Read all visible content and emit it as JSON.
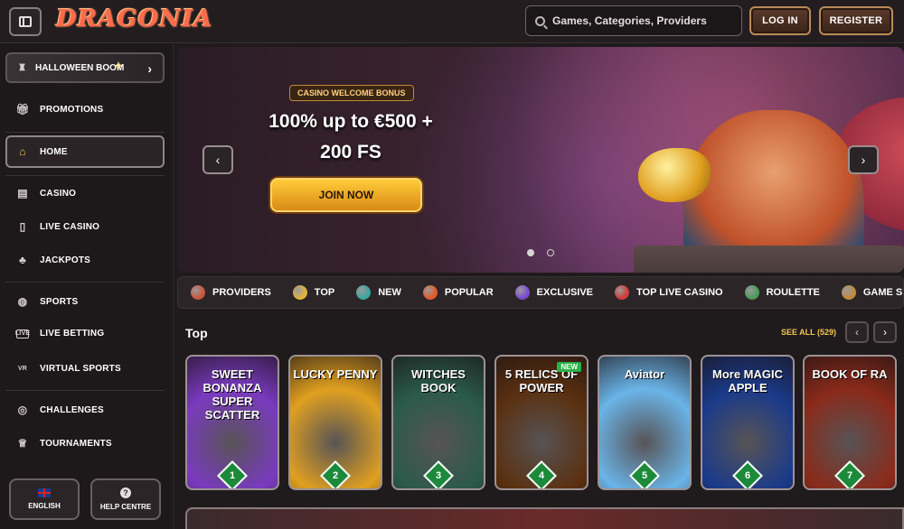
{
  "app": {
    "logo_text": "DRAGONIA"
  },
  "header": {
    "search_placeholder": "Games, Categories, Providers",
    "login_label": "LOG IN",
    "register_label": "REGISTER"
  },
  "sidebar": {
    "promo_banner": "HALLOWEEN BOOM",
    "items": [
      {
        "label": "PROMOTIONS",
        "icon": "gift-icon"
      },
      {
        "label": "HOME",
        "icon": "home-icon"
      },
      {
        "label": "CASINO",
        "icon": "slot-icon"
      },
      {
        "label": "LIVE CASINO",
        "icon": "cards-icon"
      },
      {
        "label": "JACKPOTS",
        "icon": "clover-icon"
      },
      {
        "label": "SPORTS",
        "icon": "basketball-icon"
      },
      {
        "label": "LIVE BETTING",
        "icon": "live-icon"
      },
      {
        "label": "VIRTUAL SPORTS",
        "icon": "vr-icon"
      },
      {
        "label": "CHALLENGES",
        "icon": "target-icon"
      },
      {
        "label": "TOURNAMENTS",
        "icon": "trophy-icon"
      }
    ],
    "language_label": "ENGLISH",
    "help_label": "HELP CENTRE"
  },
  "banner": {
    "tag": "CASINO WELCOME BONUS",
    "line1": "100% up to €500 +",
    "line2": "200 FS",
    "cta": "JOIN NOW"
  },
  "categories": [
    {
      "label": "PROVIDERS",
      "color": "#c9553a"
    },
    {
      "label": "TOP",
      "color": "#e0b43a"
    },
    {
      "label": "NEW",
      "color": "#3aa6a0"
    },
    {
      "label": "POPULAR",
      "color": "#e05a2a"
    },
    {
      "label": "EXCLUSIVE",
      "color": "#7a4ad0"
    },
    {
      "label": "TOP LIVE CASINO",
      "color": "#d03a3a"
    },
    {
      "label": "ROULETTE",
      "color": "#4a9a5a"
    },
    {
      "label": "GAME SHOWS",
      "color": "#c08a3a"
    }
  ],
  "top_section": {
    "title": "Top",
    "see_all": "SEE ALL (529)"
  },
  "games": [
    {
      "title": "SWEET BONANZA SUPER SCATTER",
      "rank": "1",
      "bg": "#7a3ac0",
      "new": ""
    },
    {
      "title": "LUCKY PENNY",
      "rank": "2",
      "bg": "#e0a020",
      "new": ""
    },
    {
      "title": "WITCHES BOOK",
      "rank": "3",
      "bg": "#2a5a4a",
      "new": ""
    },
    {
      "title": "5 RELICS OF POWER",
      "rank": "4",
      "bg": "#5a3010",
      "new": "NEW"
    },
    {
      "title": "Aviator",
      "rank": "5",
      "bg": "#6ab4e8",
      "new": ""
    },
    {
      "title": "More MAGIC APPLE",
      "rank": "6",
      "bg": "#1a3a8a",
      "new": ""
    },
    {
      "title": "BOOK OF RA",
      "rank": "7",
      "bg": "#8a2a1a",
      "new": ""
    }
  ]
}
